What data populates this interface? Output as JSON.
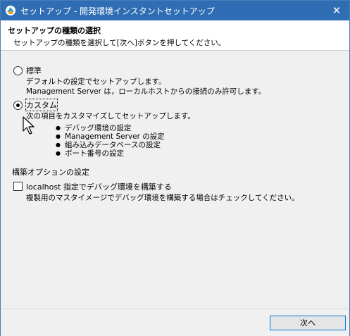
{
  "window": {
    "title": "セットアップ - 開発環境インスタントセットアップ",
    "close_glyph": "✕"
  },
  "header": {
    "heading": "セットアップの種類の選択",
    "instruction": "セットアップの種類を選択して[次へ]ボタンを押してください。"
  },
  "options": {
    "standard": {
      "label": "標準",
      "desc1": "デフォルトの設定でセットアップします。",
      "desc2": "Management Server は，ローカルホストからの接続のみ許可します。",
      "selected": false
    },
    "custom": {
      "label": "カスタム",
      "desc1": "次の項目をカスタマイズしてセットアップします。",
      "selected": true,
      "items": [
        "デバッグ環境の設定",
        "Management Server の設定",
        "組み込みデータベースの設定",
        "ポート番号の設定"
      ]
    }
  },
  "build_options": {
    "section_label": "構築オプションの設定",
    "localhost_checkbox": {
      "label": "localhost 指定でデバッグ環境を構築する",
      "checked": false,
      "hint": "複製用のマスタイメージでデバッグ環境を構築する場合はチェックしてください。"
    }
  },
  "footer": {
    "next_label": "次へ"
  },
  "colors": {
    "titlebar": "#2f6eb5",
    "button_border": "#0078d7",
    "window_bg": "#f0f0f0"
  },
  "icons": {
    "app": "app-icon",
    "close": "close-icon",
    "cursor": "mouse-cursor-icon"
  }
}
